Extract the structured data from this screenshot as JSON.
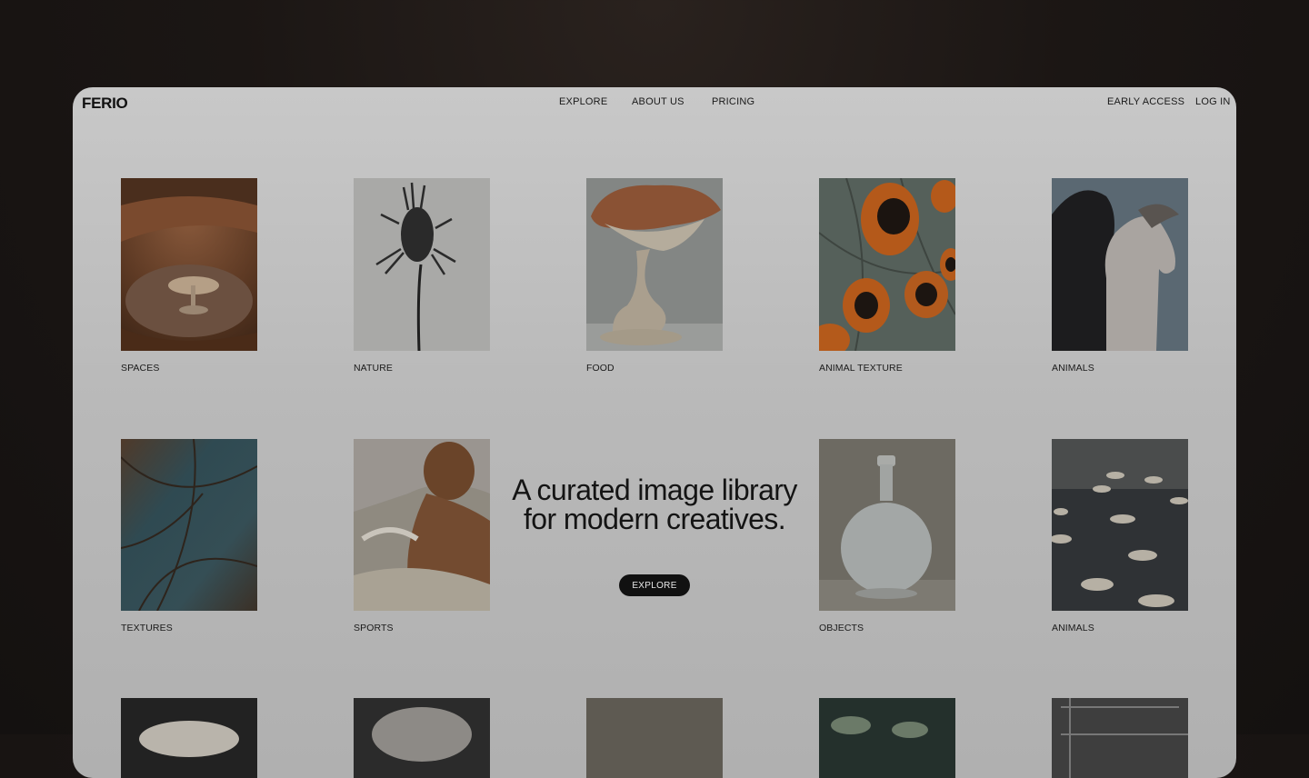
{
  "brand": "FERIO",
  "nav": {
    "center": [
      "EXPLORE",
      "ABOUT US",
      "PRICING"
    ],
    "right": [
      "EARLY ACCESS",
      "LOG IN"
    ]
  },
  "hero": {
    "title_line1": "A curated image library",
    "title_line2": "for modern creatives.",
    "button": "EXPLORE"
  },
  "tiles_row1": [
    "SPACES",
    "NATURE",
    "FOOD",
    "ANIMAL TEXTURE",
    "ANIMALS"
  ],
  "tiles_row2": [
    "TEXTURES",
    "SPORTS",
    "OBJECTS",
    "ANIMALS"
  ],
  "colors": {
    "frame_bg": "#c8c8c8",
    "page_bg": "#1b1614",
    "button_bg": "#111111"
  }
}
